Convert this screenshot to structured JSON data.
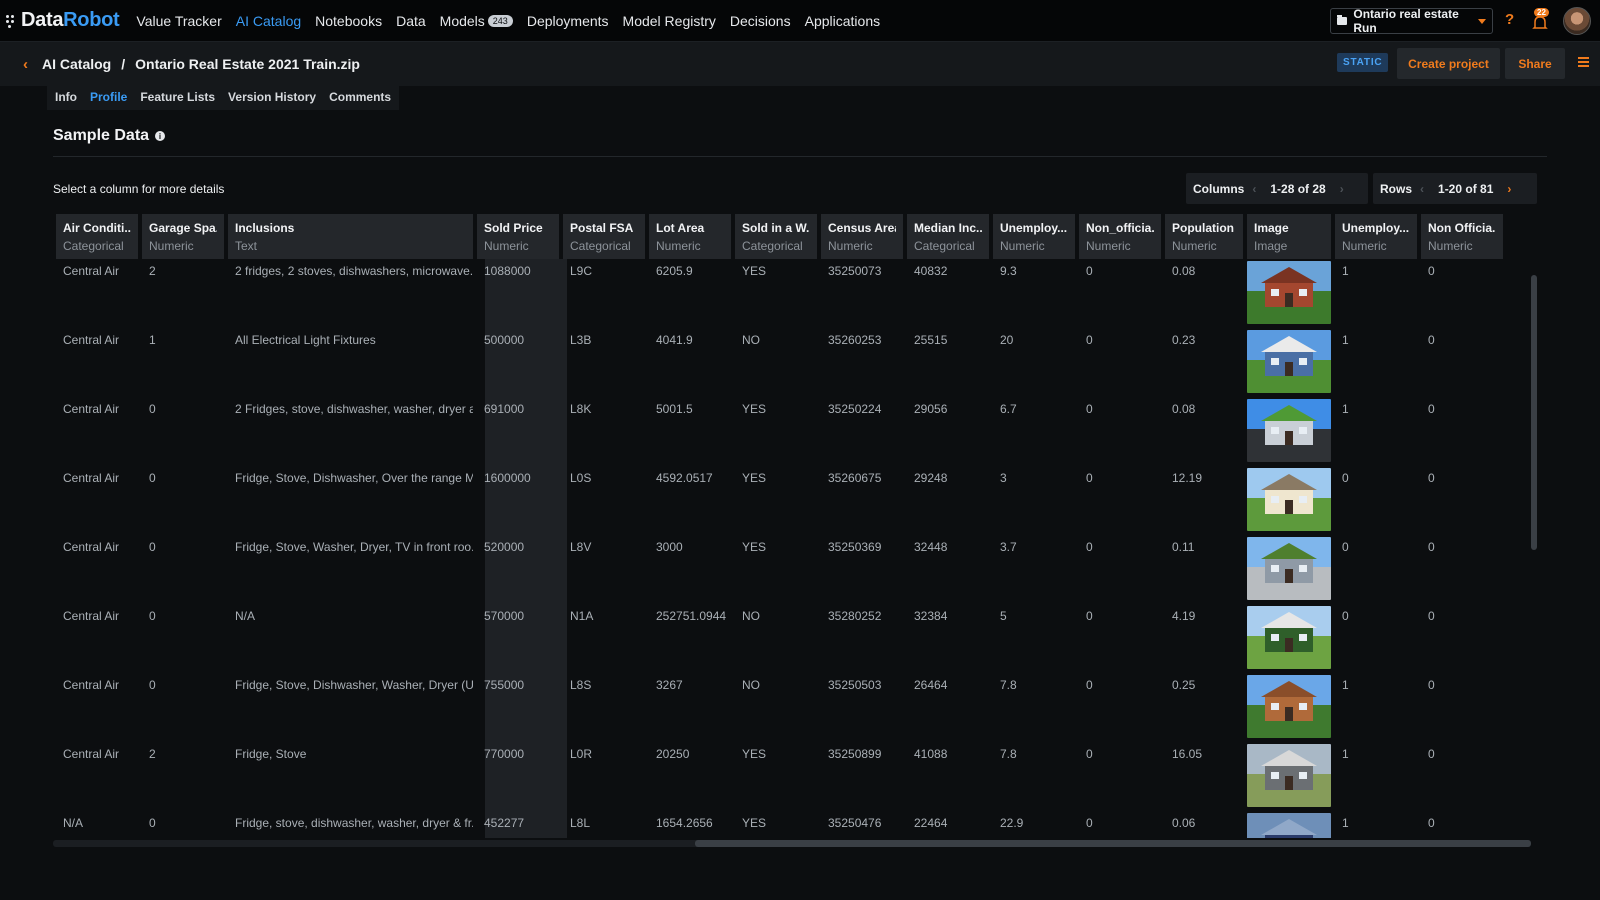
{
  "nav": {
    "logo_data": "Data",
    "logo_robot": "Robot",
    "items": [
      {
        "label": "Value Tracker"
      },
      {
        "label": "AI Catalog"
      },
      {
        "label": "Notebooks"
      },
      {
        "label": "Data"
      },
      {
        "label": "Models",
        "badge": "243"
      },
      {
        "label": "Deployments"
      },
      {
        "label": "Model Registry"
      },
      {
        "label": "Decisions"
      },
      {
        "label": "Applications"
      }
    ],
    "active_index": 1,
    "project": "Ontario real estate Run",
    "help": "?",
    "notifications": "22"
  },
  "breadcrumb": {
    "root": "AI Catalog",
    "separator": "/",
    "current": "Ontario Real Estate 2021 Train.zip"
  },
  "actions": {
    "static": "STATIC",
    "create_project": "Create project",
    "share": "Share"
  },
  "tabs": {
    "items": [
      "Info",
      "Profile",
      "Feature Lists",
      "Version History",
      "Comments"
    ],
    "active_index": 1
  },
  "section": {
    "title": "Sample Data",
    "hint": "Select a column for more details"
  },
  "pager": {
    "columns_label": "Columns",
    "columns_range": "1-28 of 28",
    "rows_label": "Rows",
    "rows_range": "1-20 of 81"
  },
  "table": {
    "columns": [
      {
        "name": "Air Conditi...",
        "type": "Categorical"
      },
      {
        "name": "Garage Spa...",
        "type": "Numeric"
      },
      {
        "name": "Inclusions",
        "type": "Text"
      },
      {
        "name": "Sold Price",
        "type": "Numeric"
      },
      {
        "name": "Postal FSA",
        "type": "Categorical"
      },
      {
        "name": "Lot Area",
        "type": "Numeric"
      },
      {
        "name": "Sold in a W...",
        "type": "Categorical"
      },
      {
        "name": "Census Area",
        "type": "Numeric"
      },
      {
        "name": "Median Inc...",
        "type": "Categorical"
      },
      {
        "name": "Unemploy...",
        "type": "Numeric"
      },
      {
        "name": "Non_officia...",
        "type": "Numeric"
      },
      {
        "name": "Population ...",
        "type": "Numeric"
      },
      {
        "name": "Image",
        "type": "Image"
      },
      {
        "name": "Unemploy...",
        "type": "Numeric"
      },
      {
        "name": "Non Officia...",
        "type": "Numeric"
      }
    ],
    "rows": [
      {
        "cells": [
          "Central Air",
          "2",
          "2 fridges, 2 stoves, dishwashers, microwave...",
          "1088000",
          "L9C",
          "6205.9",
          "YES",
          "35250073",
          "40832",
          "9.3",
          "0",
          "0.08",
          "",
          "1",
          "0"
        ],
        "image": "house-red-brick"
      },
      {
        "cells": [
          "Central Air",
          "1",
          "All Electrical Light Fixtures",
          "500000",
          "L3B",
          "4041.9",
          "NO",
          "35260253",
          "25515",
          "20",
          "0",
          "0.23",
          "",
          "1",
          "0"
        ],
        "image": "house-blue-bungalow"
      },
      {
        "cells": [
          "Central Air",
          "0",
          "2 Fridges, stove, dishwasher, washer, dryer a...",
          "691000",
          "L8K",
          "5001.5",
          "YES",
          "35250224",
          "29056",
          "6.7",
          "0",
          "0.08",
          "",
          "1",
          "0"
        ],
        "image": "house-driveway"
      },
      {
        "cells": [
          "Central Air",
          "0",
          "Fridge, Stove, Dishwasher, Over the range Mi...",
          "1600000",
          "L0S",
          "4592.0517",
          "YES",
          "35260675",
          "29248",
          "3",
          "0",
          "12.19",
          "",
          "0",
          "0"
        ],
        "image": "house-white-two-storey"
      },
      {
        "cells": [
          "Central Air",
          "0",
          "Fridge, Stove, Washer, Dryer, TV in front roo...",
          "520000",
          "L8V",
          "3000",
          "YES",
          "35250369",
          "32448",
          "3.7",
          "0",
          "0.11",
          "",
          "0",
          "0"
        ],
        "image": "house-grey-siding"
      },
      {
        "cells": [
          "Central Air",
          "0",
          "N/A",
          "570000",
          "N1A",
          "252751.0944",
          "NO",
          "35280252",
          "32384",
          "5",
          "0",
          "4.19",
          "",
          "0",
          "0"
        ],
        "image": "house-rural-lawn"
      },
      {
        "cells": [
          "Central Air",
          "0",
          "Fridge, Stove, Dishwasher, Washer, Dryer (Up...",
          "755000",
          "L8S",
          "3267",
          "NO",
          "35250503",
          "26464",
          "7.8",
          "0",
          "0.25",
          "",
          "1",
          "0"
        ],
        "image": "house-brick-porch"
      },
      {
        "cells": [
          "Central Air",
          "2",
          "Fridge, Stove",
          "770000",
          "L0R",
          "20250",
          "YES",
          "35250899",
          "41088",
          "7.8",
          "0",
          "16.05",
          "",
          "1",
          "0"
        ],
        "image": "house-ranch"
      },
      {
        "cells": [
          "N/A",
          "0",
          "Fridge, stove, dishwasher, washer, dryer & fr...",
          "452277",
          "L8L",
          "1654.2656",
          "YES",
          "35250476",
          "22464",
          "22.9",
          "0",
          "0.06",
          "",
          "1",
          "0"
        ],
        "image": "house-partial"
      }
    ]
  }
}
